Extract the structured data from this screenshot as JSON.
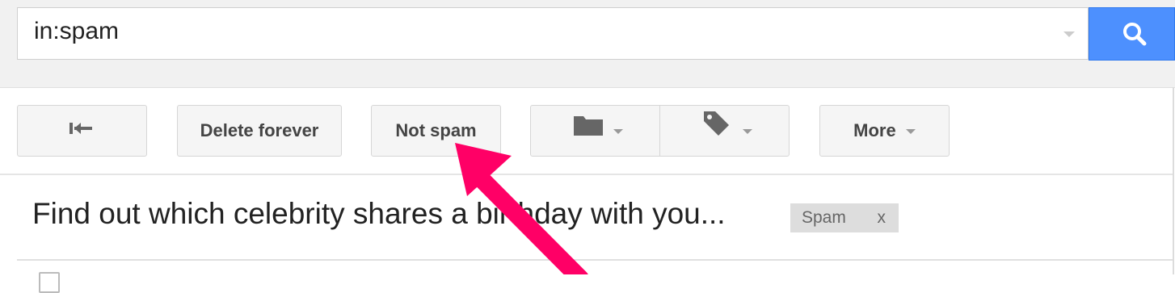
{
  "search": {
    "query": "in:spam"
  },
  "toolbar": {
    "back_icon": "back-arrow-icon",
    "delete_forever_label": "Delete forever",
    "not_spam_label": "Not spam",
    "move_to_icon": "folder-icon",
    "labels_icon": "tag-icon",
    "more_label": "More"
  },
  "message": {
    "subject": "Find out which celebrity shares a birthday with you...",
    "label": {
      "name": "Spam",
      "remove": "x",
      "color": "#dddddd"
    }
  },
  "annotation": {
    "type": "arrow",
    "color": "#ff0066",
    "points_to": "Not spam"
  },
  "colors": {
    "search_button": "#4d90fe",
    "band": "#f1f1f1"
  }
}
